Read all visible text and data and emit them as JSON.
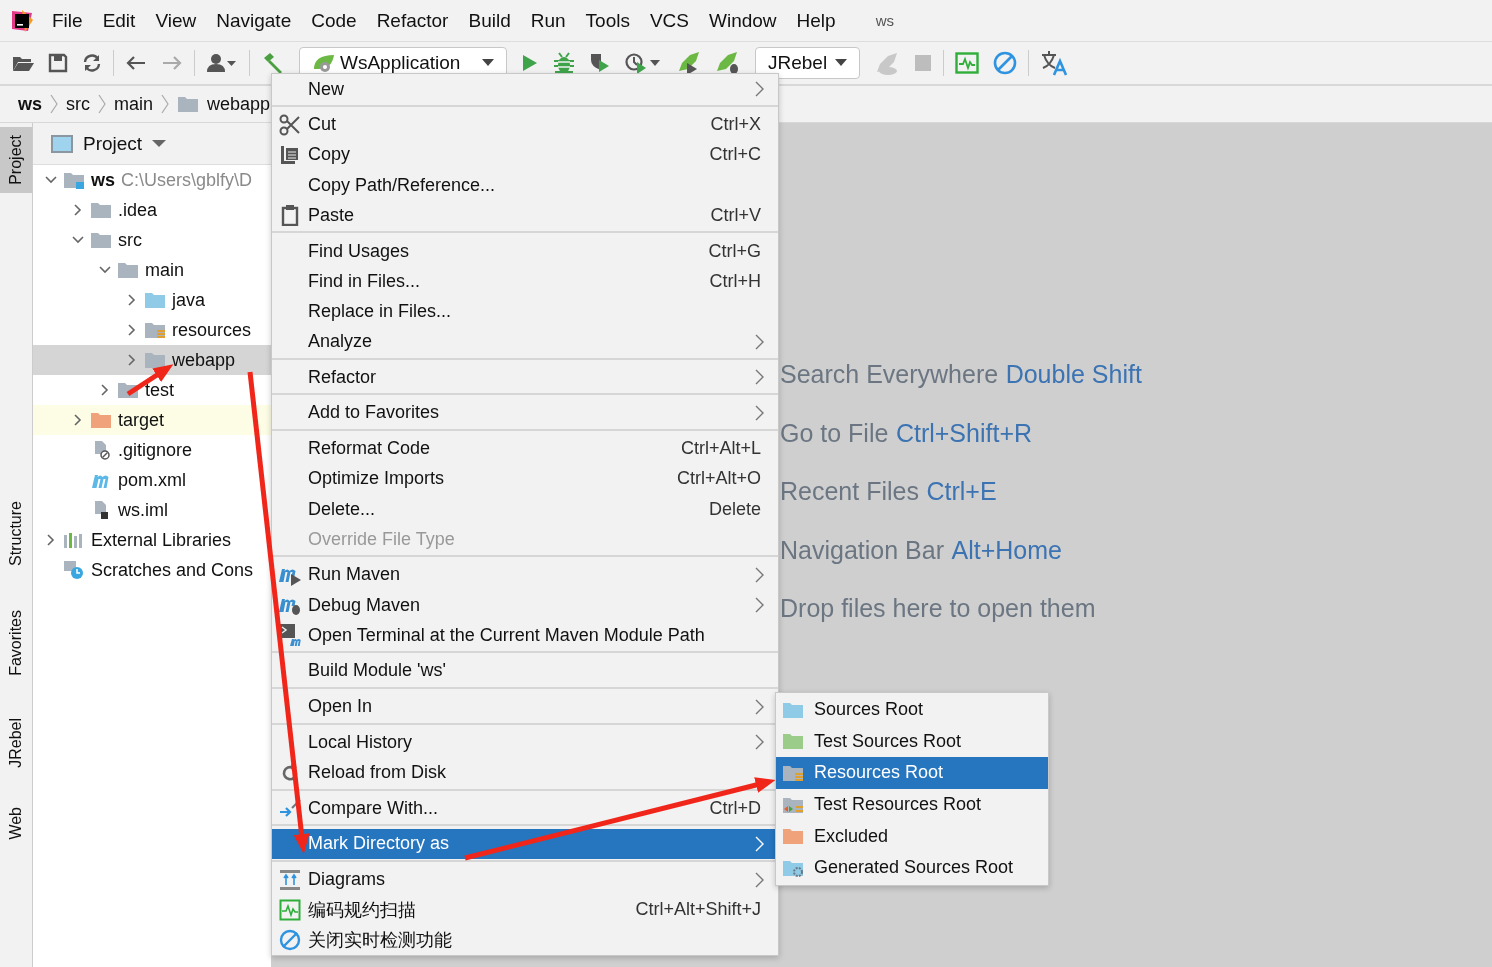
{
  "menu_bar": {
    "items": [
      "File",
      "Edit",
      "View",
      "Navigate",
      "Code",
      "Refactor",
      "Build",
      "Run",
      "Tools",
      "VCS",
      "Window",
      "Help"
    ],
    "project_title": "ws"
  },
  "toolbar": {
    "run_config": "WsApplication",
    "jrebel_config": "JRebel"
  },
  "breadcrumbs": [
    "ws",
    "src",
    "main",
    "webapp"
  ],
  "tool_strip": [
    {
      "label": "Project",
      "selected": true
    },
    {
      "label": "Structure",
      "selected": false
    },
    {
      "label": "Favorites",
      "selected": false
    },
    {
      "label": "JRebel",
      "selected": false
    },
    {
      "label": "Web",
      "selected": false
    }
  ],
  "project_panel": {
    "title": "Project",
    "tree": [
      {
        "name": "ws",
        "path": "C:\\Users\\gblfy\\D",
        "kind": "module",
        "expanded": true,
        "selected": false,
        "highlighted": false,
        "children": [
          {
            "name": ".idea",
            "kind": "folder",
            "expanded": false,
            "selected": false,
            "highlighted": false
          },
          {
            "name": "src",
            "kind": "folder",
            "expanded": true,
            "selected": false,
            "highlighted": false,
            "children": [
              {
                "name": "main",
                "kind": "folder",
                "expanded": true,
                "selected": false,
                "highlighted": false,
                "children": [
                  {
                    "name": "java",
                    "kind": "source-folder",
                    "expanded": false,
                    "selected": false,
                    "highlighted": false
                  },
                  {
                    "name": "resources",
                    "kind": "resource-folder",
                    "expanded": false,
                    "selected": false,
                    "highlighted": false
                  },
                  {
                    "name": "webapp",
                    "kind": "folder",
                    "expanded": false,
                    "selected": true,
                    "highlighted": false
                  }
                ]
              },
              {
                "name": "test",
                "kind": "folder",
                "expanded": false,
                "selected": false,
                "highlighted": false
              }
            ]
          },
          {
            "name": "target",
            "kind": "excluded-folder",
            "expanded": false,
            "selected": false,
            "highlighted": true
          },
          {
            "name": ".gitignore",
            "kind": "ignore-file",
            "selected": false,
            "highlighted": false
          },
          {
            "name": "pom.xml",
            "kind": "maven-file",
            "selected": false,
            "highlighted": false
          },
          {
            "name": "ws.iml",
            "kind": "iml-file",
            "selected": false,
            "highlighted": false
          }
        ]
      },
      {
        "name": "External Libraries",
        "kind": "libraries",
        "expanded": false,
        "selected": false,
        "highlighted": false
      },
      {
        "name": "Scratches and Cons",
        "kind": "scratches",
        "selected": false,
        "highlighted": false
      }
    ]
  },
  "editor_hints": [
    {
      "text": "Search Everywhere",
      "shortcut": "Double Shift"
    },
    {
      "text": "Go to File",
      "shortcut": "Ctrl+Shift+R"
    },
    {
      "text": "Recent Files",
      "shortcut": "Ctrl+E"
    },
    {
      "text": "Navigation Bar",
      "shortcut": "Alt+Home"
    },
    {
      "text": "Drop files here to open them"
    }
  ],
  "context_menu": {
    "groups": [
      [
        {
          "label": "New",
          "submenu": true,
          "disabled": false,
          "selected": false
        }
      ],
      [
        {
          "label": "Cut",
          "shortcut": "Ctrl+X",
          "submenu": false,
          "disabled": false,
          "selected": false
        },
        {
          "label": "Copy",
          "shortcut": "Ctrl+C",
          "submenu": false,
          "disabled": false,
          "selected": false
        },
        {
          "label": "Copy Path/Reference...",
          "submenu": false,
          "disabled": false,
          "selected": false
        },
        {
          "label": "Paste",
          "shortcut": "Ctrl+V",
          "submenu": false,
          "disabled": false,
          "selected": false
        }
      ],
      [
        {
          "label": "Find Usages",
          "shortcut": "Ctrl+G",
          "submenu": false,
          "disabled": false,
          "selected": false
        },
        {
          "label": "Find in Files...",
          "shortcut": "Ctrl+H",
          "submenu": false,
          "disabled": false,
          "selected": false
        },
        {
          "label": "Replace in Files...",
          "submenu": false,
          "disabled": false,
          "selected": false
        },
        {
          "label": "Analyze",
          "submenu": true,
          "disabled": false,
          "selected": false
        }
      ],
      [
        {
          "label": "Refactor",
          "submenu": true,
          "disabled": false,
          "selected": false
        }
      ],
      [
        {
          "label": "Add to Favorites",
          "submenu": true,
          "disabled": false,
          "selected": false
        }
      ],
      [
        {
          "label": "Reformat Code",
          "shortcut": "Ctrl+Alt+L",
          "submenu": false,
          "disabled": false,
          "selected": false
        },
        {
          "label": "Optimize Imports",
          "shortcut": "Ctrl+Alt+O",
          "submenu": false,
          "disabled": false,
          "selected": false
        },
        {
          "label": "Delete...",
          "shortcut": "Delete",
          "submenu": false,
          "disabled": false,
          "selected": false
        },
        {
          "label": "Override File Type",
          "submenu": false,
          "disabled": true,
          "selected": false
        }
      ],
      [
        {
          "label": "Run Maven",
          "submenu": true,
          "disabled": false,
          "selected": false
        },
        {
          "label": "Debug Maven",
          "submenu": true,
          "disabled": false,
          "selected": false
        },
        {
          "label": "Open Terminal at the Current Maven Module Path",
          "submenu": false,
          "disabled": false,
          "selected": false
        }
      ],
      [
        {
          "label": "Build Module 'ws'",
          "submenu": false,
          "disabled": false,
          "selected": false
        }
      ],
      [
        {
          "label": "Open In",
          "submenu": true,
          "disabled": false,
          "selected": false
        }
      ],
      [
        {
          "label": "Local History",
          "submenu": true,
          "disabled": false,
          "selected": false
        },
        {
          "label": "Reload from Disk",
          "submenu": false,
          "disabled": false,
          "selected": false
        }
      ],
      [
        {
          "label": "Compare With...",
          "shortcut": "Ctrl+D",
          "submenu": false,
          "disabled": false,
          "selected": false
        }
      ],
      [
        {
          "label": "Mark Directory as",
          "submenu": true,
          "disabled": false,
          "selected": true
        }
      ],
      [
        {
          "label": "Diagrams",
          "submenu": true,
          "disabled": false,
          "selected": false
        },
        {
          "label": "编码规约扫描",
          "shortcut": "Ctrl+Alt+Shift+J",
          "submenu": false,
          "disabled": false,
          "selected": false
        },
        {
          "label": "关闭实时检测功能",
          "submenu": false,
          "disabled": false,
          "selected": false
        }
      ]
    ]
  },
  "submenu": {
    "items": [
      {
        "label": "Sources Root",
        "selected": false
      },
      {
        "label": "Test Sources Root",
        "selected": false
      },
      {
        "label": "Resources Root",
        "selected": true
      },
      {
        "label": "Test Resources Root",
        "selected": false
      },
      {
        "label": "Excluded",
        "selected": false
      },
      {
        "label": "Generated Sources Root",
        "selected": false
      }
    ]
  }
}
